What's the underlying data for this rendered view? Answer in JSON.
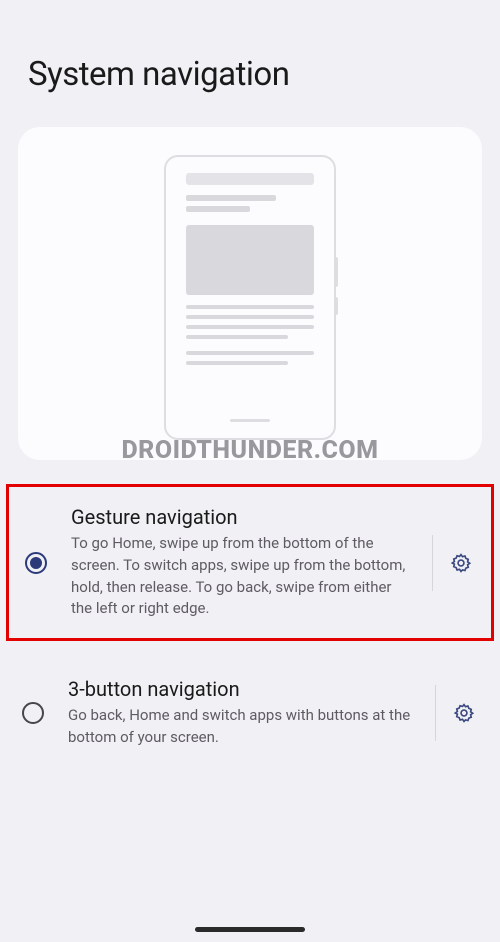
{
  "header": {
    "title": "System navigation"
  },
  "watermark": "DROIDTHUNDER.COM",
  "options": [
    {
      "title": "Gesture navigation",
      "desc": "To go Home, swipe up from the bottom of the screen. To switch apps, swipe up from the bottom, hold, then release. To go back, swipe from either the left or right edge.",
      "checked": true,
      "highlighted": true
    },
    {
      "title": "3-button navigation",
      "desc": "Go back, Home and switch apps with buttons at the bottom of your screen.",
      "checked": false,
      "highlighted": false
    }
  ]
}
